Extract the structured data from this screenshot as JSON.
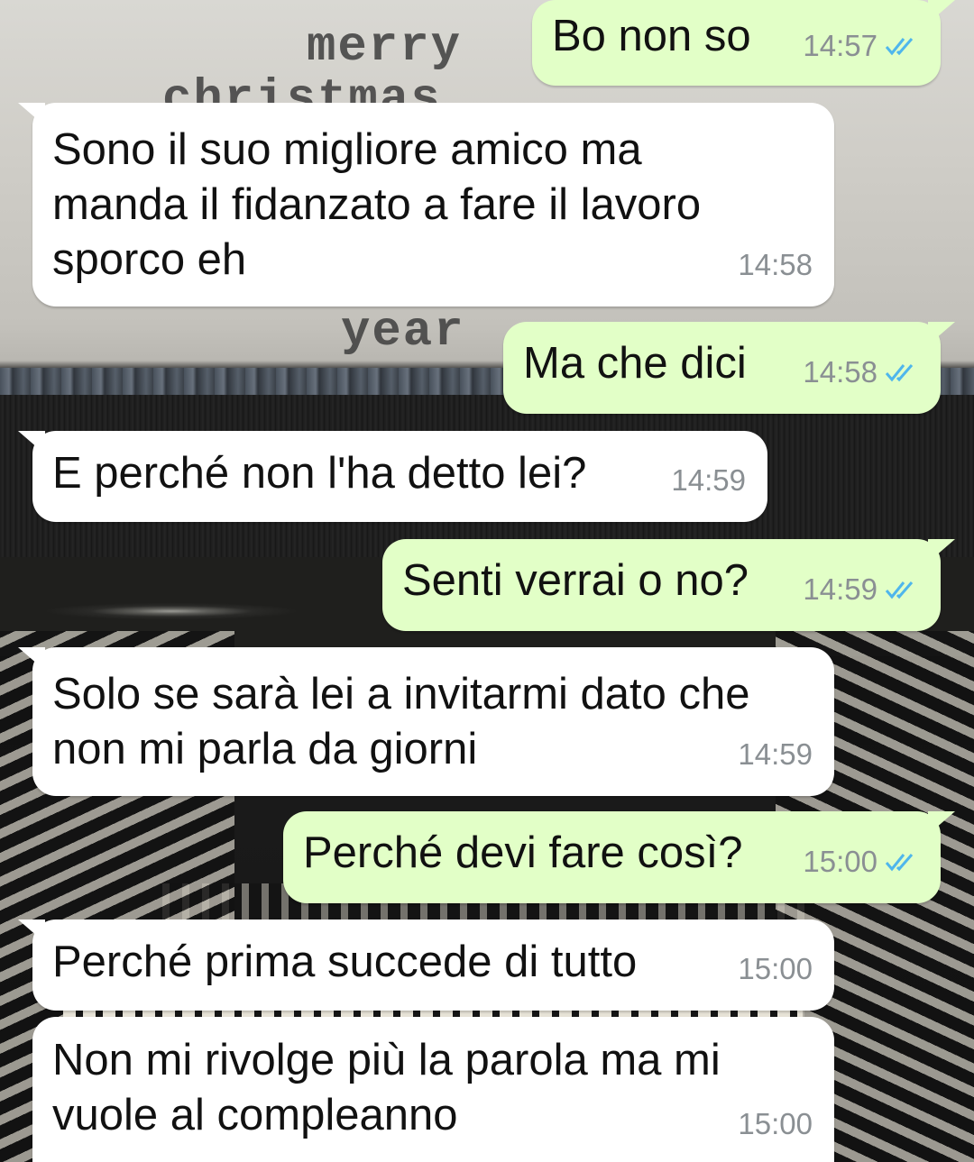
{
  "wallpaper": {
    "paper_lines": [
      "merry",
      "christmas",
      "year"
    ]
  },
  "colors": {
    "incoming_bubble": "#ffffff",
    "outgoing_bubble": "#e2ffc7",
    "read_ticks": "#4fb6ec",
    "timestamp": "#8a8f93"
  },
  "messages": [
    {
      "direction": "out",
      "text": "Bo non so",
      "time": "14:57",
      "status": "read-ticks-icon"
    },
    {
      "direction": "in",
      "text": "Sono il suo migliore amico ma manda il fidanzato a fare il lavoro sporco eh",
      "time": "14:58"
    },
    {
      "direction": "out",
      "text": "Ma che dici",
      "time": "14:58",
      "status": "read-ticks-icon"
    },
    {
      "direction": "in",
      "text": "E perché non l'ha detto lei?",
      "time": "14:59"
    },
    {
      "direction": "out",
      "text": "Senti verrai o no?",
      "time": "14:59",
      "status": "read-ticks-icon"
    },
    {
      "direction": "in",
      "text": "Solo se sarà lei a invitarmi dato che non mi parla da giorni",
      "time": "14:59"
    },
    {
      "direction": "out",
      "text": "Perché devi fare così?",
      "time": "15:00",
      "status": "read-ticks-icon"
    },
    {
      "direction": "in",
      "text": "Perché prima succede di tutto",
      "time": "15:00"
    },
    {
      "direction": "in",
      "text": "Non mi rivolge più la parola ma mi vuole al compleanno",
      "time": "15:00"
    }
  ]
}
